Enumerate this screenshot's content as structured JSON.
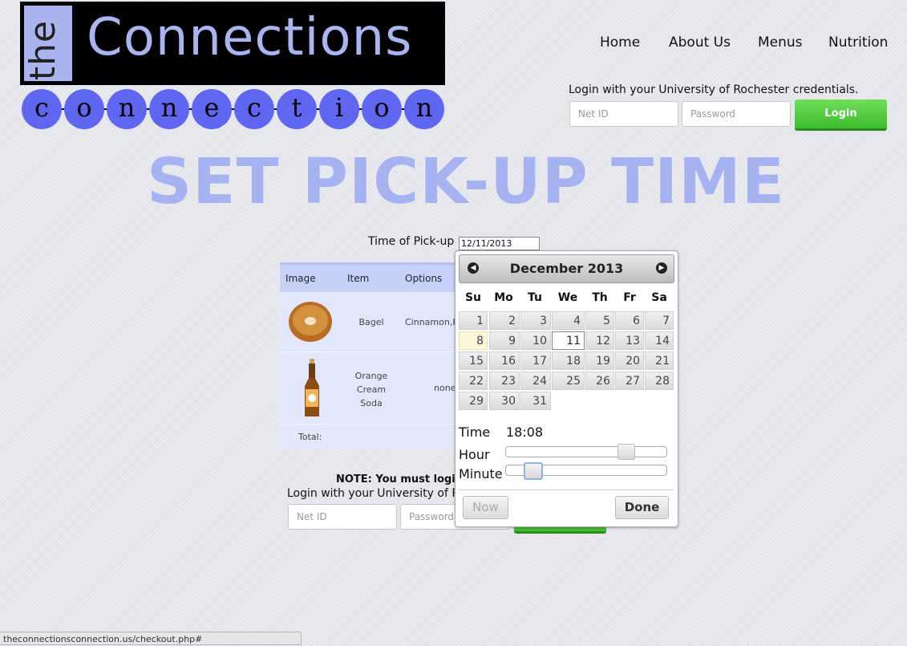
{
  "logo": {
    "the": "the",
    "connections": "Connections",
    "letters": [
      "c",
      "o",
      "n",
      "n",
      "e",
      "c",
      "t",
      "i",
      "o",
      "n"
    ]
  },
  "nav": {
    "items": [
      "Home",
      "About Us",
      "Menus",
      "Nutrition"
    ]
  },
  "login_top": {
    "label": "Login with your University of Rochester credentials.",
    "netid_placeholder": "Net ID",
    "password_placeholder": "Password",
    "button": "Login"
  },
  "page_title": "SET PICK-UP TIME",
  "pickup": {
    "label": "Time of Pick-up :",
    "value": "12/11/2013 18:08"
  },
  "cart": {
    "headers": [
      "Image",
      "Item",
      "Options"
    ],
    "rows": [
      {
        "item": "Bagel",
        "options": "Cinnamon,R",
        "image_icon": "bagel-image"
      },
      {
        "item": "Orange Cream Soda",
        "item_lines": [
          "Orange",
          "Cream",
          "Soda"
        ],
        "options": "none",
        "image_icon": "soda-bottle-image"
      }
    ],
    "total_label": "Total:"
  },
  "note": {
    "text": "NOTE: You must login t",
    "login_label": "Login with your University of Roc",
    "netid_placeholder": "Net ID",
    "password_placeholder": "Password"
  },
  "datepicker": {
    "month_title": "December 2013",
    "weekdays": [
      "Su",
      "Mo",
      "Tu",
      "We",
      "Th",
      "Fr",
      "Sa"
    ],
    "days": [
      1,
      2,
      3,
      4,
      5,
      6,
      7,
      8,
      9,
      10,
      11,
      12,
      13,
      14,
      15,
      16,
      17,
      18,
      19,
      20,
      21,
      22,
      23,
      24,
      25,
      26,
      27,
      28,
      29,
      30,
      31
    ],
    "today": 8,
    "selected": 11,
    "time_label": "Time",
    "time_value": "18:08",
    "hour_label": "Hour",
    "minute_label": "Minute",
    "hour_value": 18,
    "minute_value": 8,
    "now_button": "Now",
    "done_button": "Done",
    "prev_icon": "chevron-left-icon",
    "next_icon": "chevron-right-icon"
  },
  "status_bar": {
    "url": "theconnectionsconnection.us/checkout.php#"
  },
  "colors": {
    "accent_blue": "#aab4ee",
    "bead_blue": "#5f66ef",
    "green": "#4ccc3a",
    "title_blue": "#a7b3f0"
  }
}
